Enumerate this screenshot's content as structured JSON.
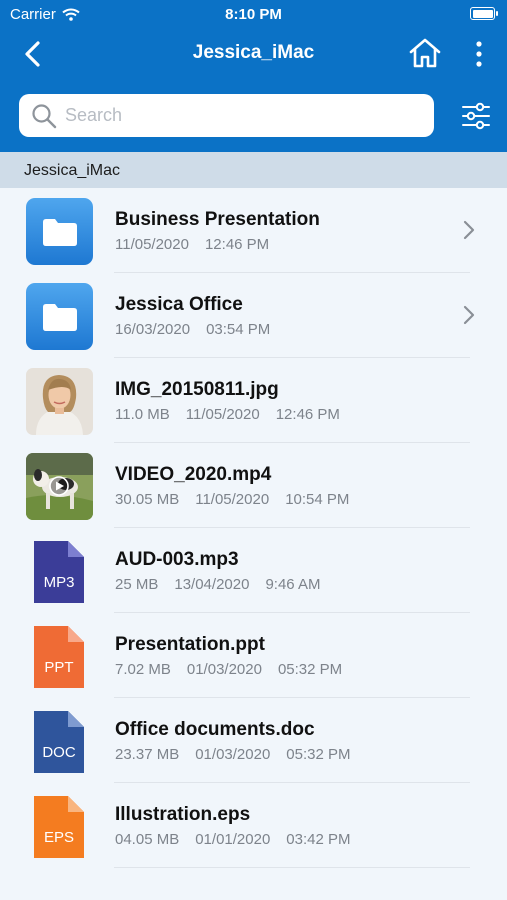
{
  "status_bar": {
    "carrier": "Carrier",
    "time": "8:10 PM"
  },
  "nav": {
    "title": "Jessica_iMac",
    "back_icon": "chevron-left-icon",
    "home_icon": "home-icon",
    "more_icon": "more-vertical-icon"
  },
  "search": {
    "placeholder": "Search",
    "value": ""
  },
  "section": {
    "title": "Jessica_iMac"
  },
  "colors": {
    "header": "#0b72c6",
    "folder": "#2d8ae0",
    "mp3": "#3b3d98",
    "ppt": "#ef6b35",
    "doc": "#2f559c",
    "eps": "#f47c20"
  },
  "files": [
    {
      "name": "Business Presentation",
      "kind": "folder",
      "date": "11/05/2020",
      "time": "12:46 PM"
    },
    {
      "name": "Jessica Office",
      "kind": "folder",
      "date": "16/03/2020",
      "time": "03:54 PM"
    },
    {
      "name": "IMG_20150811.jpg",
      "kind": "image",
      "size": "11.0 MB",
      "date": "11/05/2020",
      "time": "12:46 PM"
    },
    {
      "name": "VIDEO_2020.mp4",
      "kind": "video",
      "size": "30.05 MB",
      "date": "11/05/2020",
      "time": "10:54 PM"
    },
    {
      "name": "AUD-003.mp3",
      "kind": "file",
      "badge": "MP3",
      "size": "25 MB",
      "date": "13/04/2020",
      "time": "9:46 AM"
    },
    {
      "name": "Presentation.ppt",
      "kind": "file",
      "badge": "PPT",
      "size": "7.02 MB",
      "date": "01/03/2020",
      "time": "05:32 PM"
    },
    {
      "name": "Office documents.doc",
      "kind": "file",
      "badge": "DOC",
      "size": "23.37 MB",
      "date": "01/03/2020",
      "time": "05:32 PM"
    },
    {
      "name": "Illustration.eps",
      "kind": "file",
      "badge": "EPS",
      "size": "04.05 MB",
      "date": "01/01/2020",
      "time": "03:42 PM"
    }
  ]
}
